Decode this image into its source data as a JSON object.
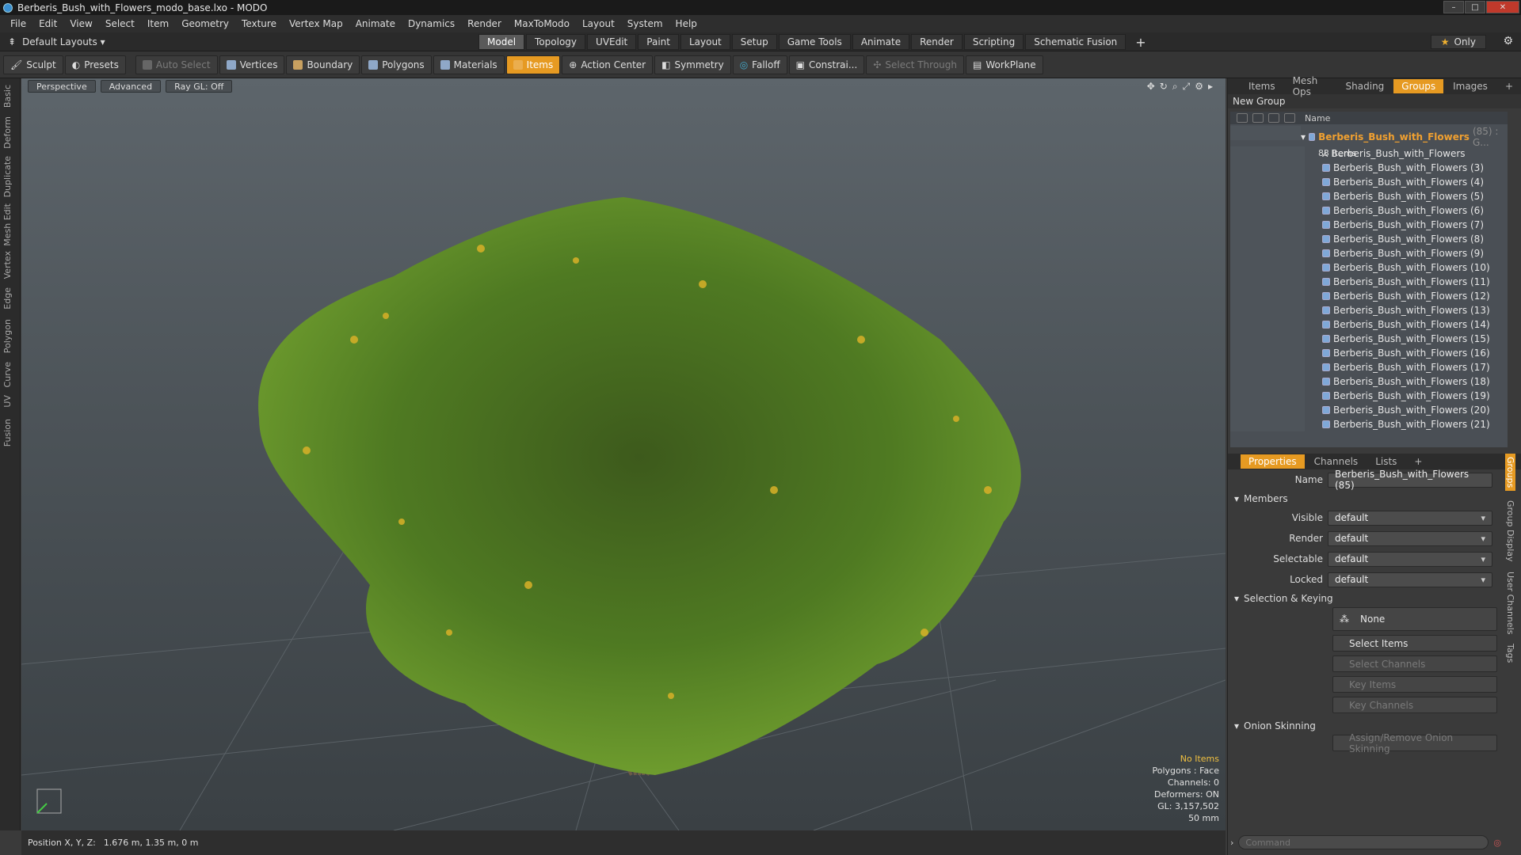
{
  "window": {
    "title": "Berberis_Bush_with_Flowers_modo_base.lxo - MODO",
    "min": "–",
    "max": "□",
    "close": "✕"
  },
  "menu": [
    "File",
    "Edit",
    "View",
    "Select",
    "Item",
    "Geometry",
    "Texture",
    "Vertex Map",
    "Animate",
    "Dynamics",
    "Render",
    "MaxToModo",
    "Layout",
    "System",
    "Help"
  ],
  "layout": {
    "selector": "Default Layouts ▾",
    "tabs": [
      "Model",
      "Topology",
      "UVEdit",
      "Paint",
      "Layout",
      "Setup",
      "Game Tools",
      "Animate",
      "Render",
      "Scripting",
      "Schematic Fusion"
    ],
    "active_tab": "Model",
    "plus": "+",
    "only": "Only"
  },
  "toolbar": {
    "sculpt": "Sculpt",
    "presets": "Presets",
    "auto_select": "Auto Select",
    "vertices": "Vertices",
    "boundary": "Boundary",
    "polygons": "Polygons",
    "materials": "Materials",
    "items": "Items",
    "action_center": "Action Center",
    "symmetry": "Symmetry",
    "falloff": "Falloff",
    "constrain": "Constrai...",
    "select_through": "Select Through",
    "workplane": "WorkPlane"
  },
  "left_tabs": [
    "Basic",
    "Deform",
    "Duplicate",
    "Mesh Edit",
    "Vertex",
    "Edge",
    "Polygon",
    "Curve",
    "UV",
    "Fusion"
  ],
  "viewport": {
    "view": "Perspective",
    "mode": "Advanced",
    "raygl": "Ray GL: Off",
    "info": {
      "items": "No Items",
      "polygons": "Polygons : Face",
      "channels": "Channels: 0",
      "deformers": "Deformers: ON",
      "gl": "GL: 3,157,502",
      "focal": "50 mm"
    }
  },
  "status": {
    "position_label": "Position X, Y, Z:",
    "position_value": "1.676 m, 1.35 m, 0 m"
  },
  "right_tabs": [
    "Items",
    "Mesh Ops",
    "Shading",
    "Groups",
    "Images"
  ],
  "right_active": "Groups",
  "groups": {
    "new_group": "New Group",
    "col_name": "Name",
    "group_name": "Berberis_Bush_with_Flowers",
    "group_suffix": "(85) : G...",
    "group_count": "83 Items",
    "items": [
      "Berberis_Bush_with_Flowers",
      "Berberis_Bush_with_Flowers (3)",
      "Berberis_Bush_with_Flowers (4)",
      "Berberis_Bush_with_Flowers (5)",
      "Berberis_Bush_with_Flowers (6)",
      "Berberis_Bush_with_Flowers (7)",
      "Berberis_Bush_with_Flowers (8)",
      "Berberis_Bush_with_Flowers (9)",
      "Berberis_Bush_with_Flowers (10)",
      "Berberis_Bush_with_Flowers (11)",
      "Berberis_Bush_with_Flowers (12)",
      "Berberis_Bush_with_Flowers (13)",
      "Berberis_Bush_with_Flowers (14)",
      "Berberis_Bush_with_Flowers (15)",
      "Berberis_Bush_with_Flowers (16)",
      "Berberis_Bush_with_Flowers (17)",
      "Berberis_Bush_with_Flowers (18)",
      "Berberis_Bush_with_Flowers (19)",
      "Berberis_Bush_with_Flowers (20)",
      "Berberis_Bush_with_Flowers (21)"
    ]
  },
  "props_tabs": [
    "Properties",
    "Channels",
    "Lists"
  ],
  "properties": {
    "name_label": "Name",
    "name_value": "Berberis_Bush_with_Flowers (85)",
    "members": "Members",
    "visible_label": "Visible",
    "visible": "default",
    "render_label": "Render",
    "render": "default",
    "selectable_label": "Selectable",
    "selectable": "default",
    "locked_label": "Locked",
    "locked": "default",
    "sel_keying": "Selection & Keying",
    "none": "None",
    "select_items": "Select Items",
    "select_channels": "Select Channels",
    "key_items": "Key Items",
    "key_channels": "Key Channels",
    "onion": "Onion Skinning",
    "assign_onion": "Assign/Remove Onion Skinning"
  },
  "props_side_tabs": [
    "Groups",
    "Group Display",
    "User Channels",
    "Tags"
  ],
  "command": {
    "placeholder": "Command"
  },
  "colors": {
    "accent": "#e69a22",
    "group_name": "#f0a030",
    "info_yellow": "#f0c040"
  }
}
